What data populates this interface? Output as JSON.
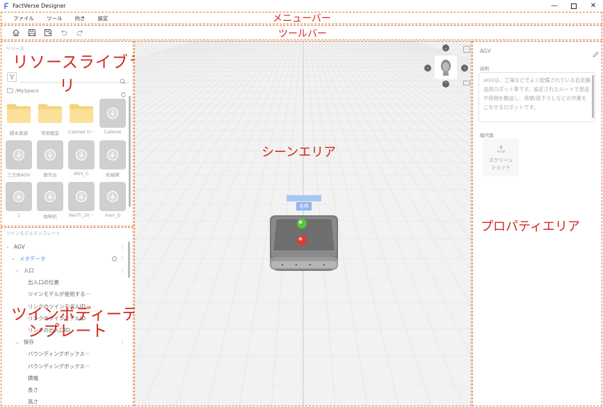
{
  "window": {
    "title": "FactVerse Designer"
  },
  "menubar": {
    "items": [
      "ファイル",
      "ツール",
      "向き",
      "設定"
    ]
  },
  "annotations": {
    "menubar": "メニューバー",
    "toolbar": "ツールバー",
    "resource_library_line1": "リソースライブラ",
    "resource_library_line2": "リ",
    "scene_area": "シーンエリア",
    "property_area": "プロパティエリア",
    "twin_template_line1": "ツインボディーテ",
    "twin_template_line2": "ンプレート"
  },
  "resource_panel": {
    "header": "リソース",
    "path": "/MySpace",
    "tiles": [
      {
        "label": "脚本資源",
        "kind": "folder"
      },
      {
        "label": "常用模型",
        "kind": "folder"
      },
      {
        "label": "Cabinet O···",
        "kind": "folder"
      },
      {
        "label": "Cabinet",
        "kind": "model"
      },
      {
        "label": "三方体AGV",
        "kind": "model"
      },
      {
        "label": "操作台",
        "kind": "model"
      },
      {
        "label": "AGV_C",
        "kind": "model"
      },
      {
        "label": "机械臂",
        "kind": "model"
      },
      {
        "label": "1",
        "kind": "model"
      },
      {
        "label": "咖啡机",
        "kind": "model"
      },
      {
        "label": "RenTi_20···",
        "kind": "model"
      },
      {
        "label": "men_G",
        "kind": "model"
      }
    ]
  },
  "twin_panel": {
    "header": "ツインモデルテンプレート",
    "rows": [
      {
        "label": "AGV",
        "indent": 0,
        "arrow": true,
        "menu": true
      },
      {
        "label": "メタデータ",
        "indent": 1,
        "arrow": true,
        "menu": true,
        "highlight": true
      },
      {
        "label": "入口",
        "indent": 2,
        "arrow": true,
        "menu": true
      },
      {
        "label": "出入口の位置",
        "indent": 3
      },
      {
        "label": "ツインモデルが使用する···",
        "indent": 3
      },
      {
        "label": "リンクのツインモデルID",
        "indent": 3
      },
      {
        "label": "リンクのツインモデルID",
        "indent": 3
      },
      {
        "label": "リンクの出入口ID",
        "indent": 3
      },
      {
        "label": "保存",
        "indent": 2,
        "arrow": true,
        "menu": true
      },
      {
        "label": "バウンディングボックス···",
        "indent": 3
      },
      {
        "label": "バウンディングボックス···",
        "indent": 3
      },
      {
        "label": "横幅",
        "indent": 3
      },
      {
        "label": "長さ",
        "indent": 3
      },
      {
        "label": "高さ",
        "indent": 3
      }
    ]
  },
  "scene": {
    "object_label": "名称"
  },
  "properties": {
    "name": "AGV",
    "description_label": "説明",
    "description": "AGVは、工場などでよく配備されている自走搬送用ロボット車です。設定されたルートで部品や荷物を輸送し、荷積/荷下ろしなどの作業をこなせるロボットです。",
    "thumbnail_label": "縮尺図",
    "screenshot_label_1": "スクリーン",
    "screenshot_label_2": "ショット"
  },
  "colors": {
    "annotation": "#d0281e",
    "dashed_border": "#d9763a",
    "accent_blue": "#5b8def"
  }
}
